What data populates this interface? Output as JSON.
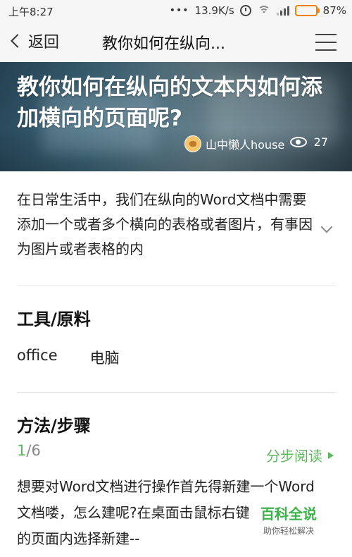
{
  "status_bar": {
    "time": "上午8:27",
    "network_speed": "13.9K/s",
    "battery": "87%",
    "battery_level": 0.87
  },
  "nav": {
    "back_label": "返回",
    "title": "教你如何在纵向..."
  },
  "hero": {
    "title": "教你如何在纵向的文本内如何添加横向的页面呢?",
    "author": "山中懒人house",
    "views": "27"
  },
  "intro": {
    "text": "在日常生活中，我们在纵向的Word文档中需要添加一个或者多个横向的表格或者图片，有事因为图片或者表格的内"
  },
  "tools_section": {
    "title": "工具/原料",
    "items": [
      "office",
      "电脑"
    ]
  },
  "method_section": {
    "title": "方法/步骤",
    "step_current": "1",
    "step_total": "/6",
    "step_read_label": "分步阅读",
    "step_text": "想要对Word文档进行操作首先得新建一个Word文档喽，怎么建呢?在桌面击鼠标右键--->在出现的页面内选择新建--"
  },
  "badge": {
    "name": "百科全说",
    "slogan": "助你轻松解决"
  },
  "colors": {
    "accent_green": "#5cb85c",
    "battery_orange": "#f08000"
  }
}
